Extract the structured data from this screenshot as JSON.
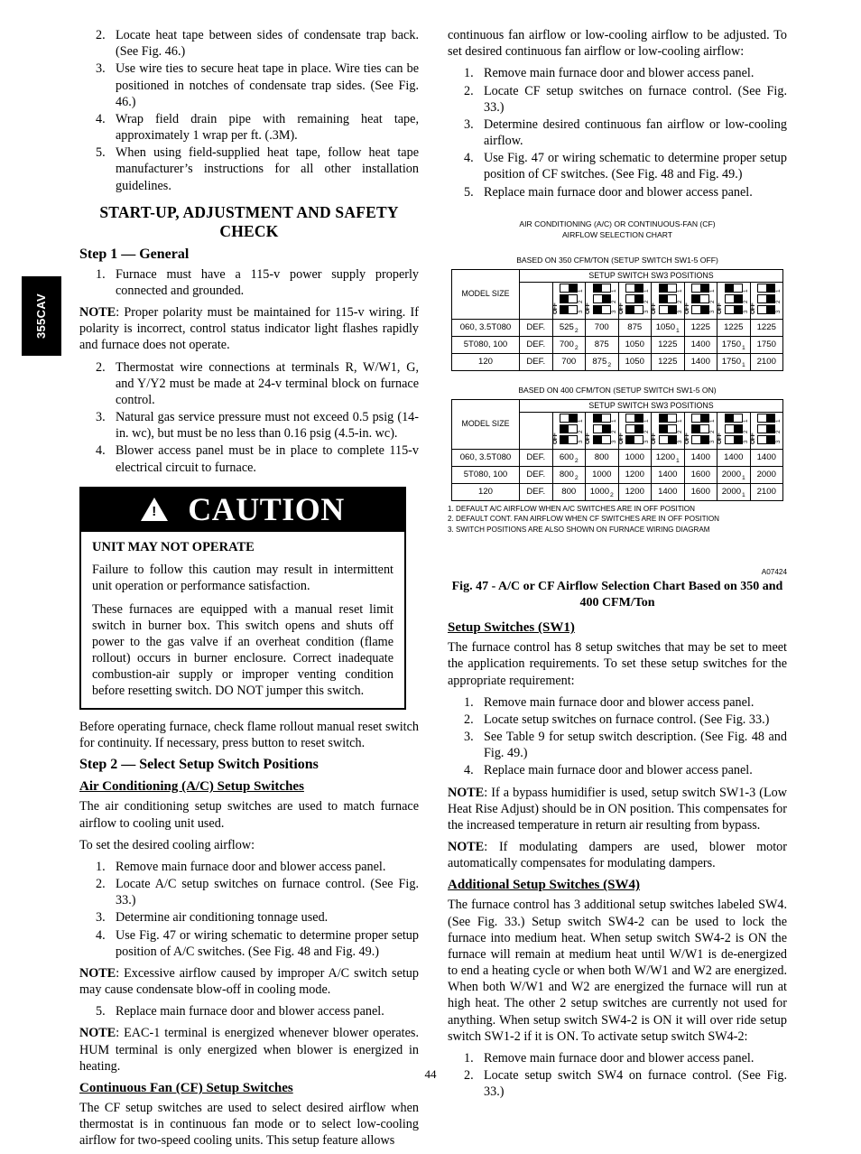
{
  "side_tab": {
    "label": "355CAV"
  },
  "page_number": "44",
  "left_column": {
    "list_a": [
      {
        "marker": "2.",
        "text": "Locate heat tape between sides of condensate trap back. (See Fig. 46.)"
      },
      {
        "marker": "3.",
        "text": "Use wire ties to secure heat tape in place. Wire ties can be positioned in notches of condensate trap sides. (See Fig. 46.)"
      },
      {
        "marker": "4.",
        "text": "Wrap field drain pipe with remaining heat tape, approximately 1 wrap per ft. (.3M)."
      },
      {
        "marker": "5.",
        "text": "When using field-supplied heat tape, follow heat tape manufacturer’s instructions for all other installation guidelines."
      }
    ],
    "section_heading": "START-UP, ADJUSTMENT AND SAFETY CHECK",
    "step1_heading": "Step 1 — General",
    "step1_item1_marker": "1.",
    "step1_item1": "Furnace must have a 115-v power supply properly connected and grounded.",
    "note1_label": "NOTE",
    "note1_text": ":  Proper polarity must be maintained for 115-v wiring. If polarity is incorrect, control status indicator light flashes rapidly and furnace does not operate.",
    "step1_rest": [
      {
        "marker": "2.",
        "text": "Thermostat wire connections at terminals R, W/W1, G, and Y/Y2 must be made at 24-v terminal block on furnace control."
      },
      {
        "marker": "3.",
        "text": "Natural gas service pressure must not exceed 0.5 psig (14-in. wc), but must be no less than 0.16 psig (4.5-in. wc)."
      },
      {
        "marker": "4.",
        "text": "Blower access panel must be in place to complete 115-v electrical circuit to furnace."
      }
    ],
    "caution": {
      "word": "CAUTION",
      "icon": "warning-triangle-icon",
      "title": "UNIT MAY NOT OPERATE",
      "paragraphs": [
        "Failure to follow this caution may result in intermittent unit operation or performance satisfaction.",
        "These furnaces are equipped with a manual reset limit switch in burner box. This switch opens and shuts off power to the gas valve if an overheat condition (flame rollout) occurs in burner enclosure. Correct inadequate combustion-air supply or improper venting condition before resetting switch. DO NOT jumper this switch."
      ]
    },
    "after_caution": "Before operating furnace, check flame rollout manual reset switch for continuity. If necessary, press button to reset switch.",
    "step2_heading": "Step 2 — Select Setup Switch Positions",
    "ac_heading": "Air Conditioning (A/C) Setup Switches",
    "ac_intro": "The air conditioning setup switches are used to match furnace airflow to cooling unit used.",
    "ac_lead": "To set the desired cooling airflow:",
    "ac_steps": [
      {
        "marker": "1.",
        "text": "Remove main furnace door and blower access panel."
      },
      {
        "marker": "2.",
        "text": "Locate A/C setup switches on furnace control. (See Fig. 33.)"
      },
      {
        "marker": "3.",
        "text": "Determine air conditioning tonnage used."
      },
      {
        "marker": "4.",
        "text": "Use Fig. 47 or wiring schematic to determine proper setup position of A/C switches. (See Fig. 48 and Fig. 49.)"
      }
    ],
    "note2_label": "NOTE",
    "note2_text": ":  Excessive airflow caused by improper A/C switch setup may cause condensate blow-off in cooling mode.",
    "ac_step5_marker": "5.",
    "ac_step5": "Replace main furnace door and blower access panel.",
    "note3_label": "NOTE",
    "note3_text": ":  EAC-1 terminal is energized whenever blower operates. HUM terminal is only energized when blower is energized in heating.",
    "cf_heading": "Continuous Fan (CF) Setup Switches",
    "cf_intro": "The CF setup switches are used to select desired airflow when thermostat is in continuous fan mode or to select low-cooling airflow for two-speed cooling units. This setup feature allows"
  },
  "right_column": {
    "cf_continued": "continuous fan airflow or low-cooling airflow to be adjusted. To set desired continuous fan airflow or low-cooling airflow:",
    "cf_steps": [
      {
        "marker": "1.",
        "text": "Remove main furnace door and blower access panel."
      },
      {
        "marker": "2.",
        "text": "Locate CF setup switches on furnace control. (See Fig. 33.)"
      },
      {
        "marker": "3.",
        "text": "Determine desired continuous fan airflow or low-cooling airflow."
      },
      {
        "marker": "4.",
        "text": "Use Fig. 47 or wiring schematic to determine proper setup position of CF switches. (See Fig. 48 and Fig. 49.)"
      },
      {
        "marker": "5.",
        "text": "Replace main furnace door and blower access panel."
      }
    ],
    "sw1_heading": "Setup Switches (SW1)",
    "sw1_intro": "The furnace control has 8 setup switches that may be set to meet the application requirements. To set these setup switches for the appropriate requirement:",
    "sw1_steps": [
      {
        "marker": "1.",
        "text": "Remove main furnace door and blower access panel."
      },
      {
        "marker": "2.",
        "text": "Locate setup switches on furnace control. (See Fig. 33.)"
      },
      {
        "marker": "3.",
        "text": "See Table 9 for setup switch description. (See Fig. 48 and Fig. 49.)"
      },
      {
        "marker": "4.",
        "text": "Replace main furnace door and blower access panel."
      }
    ],
    "note4_label": "NOTE",
    "note4_text": ":  If a bypass humidifier is used, setup switch SW1-3 (Low Heat Rise Adjust) should be in ON position. This compensates for the increased temperature in return air resulting from bypass.",
    "note5_label": "NOTE",
    "note5_text": ":       If modulating dampers are used, blower motor automatically compensates for modulating dampers.",
    "sw4_heading": "Additional Setup Switches (SW4)",
    "sw4_intro": "The furnace control has 3 additional setup switches labeled SW4. (See Fig. 33.) Setup switch SW4-2 can be used to lock the furnace into medium heat. When setup switch SW4-2 is ON the furnace will remain at medium heat until W/W1 is de-energized to end a heating cycle or when both W/W1 and W2 are energized. When both W/W1 and W2 are energized the furnace will run at high heat. The other 2 setup switches are currently not used for anything. When setup switch SW4-2 is ON it will over ride setup switch SW1-2 if it is ON. To activate setup switch SW4-2:",
    "sw4_steps": [
      {
        "marker": "1.",
        "text": "Remove main furnace door and blower access panel."
      },
      {
        "marker": "2.",
        "text": "Locate setup switch SW4 on furnace control. (See Fig. 33.)"
      }
    ]
  },
  "chart_data": {
    "type": "table",
    "title": "AIR CONDITIONING (A/C) OR CONTINUOUS-FAN (CF) AIRFLOW SELECTION CHART",
    "title_line1": "AIR CONDITIONING (A/C) OR CONTINUOUS-FAN (CF)",
    "title_line2": "AIRFLOW SELECTION CHART",
    "figure_id": "A07424",
    "figure_caption": "Fig. 47 - A/C or CF Airflow Selection Chart Based on 350 and 400 CFM/Ton",
    "column_header_group": "SETUP SWITCH SW3 POSITIONS",
    "row_header": "MODEL SIZE",
    "switch_labels": {
      "off": "OFF",
      "positions": [
        "1",
        "2",
        "3"
      ]
    },
    "footnotes": [
      "1. DEFAULT A/C AIRFLOW WHEN A/C SWITCHES ARE IN OFF POSITION",
      "2. DEFAULT CONT. FAN AIRFLOW WHEN CF SWITCHES ARE IN OFF POSITION",
      "3. SWITCH POSITIONS ARE ALSO SHOWN ON FURNACE WIRING DIAGRAM"
    ],
    "tables": [
      {
        "subtitle": "BASED ON 350 CFM/TON (SETUP SWITCH SW1-5 OFF)",
        "switch_patterns": [
          [
            1,
            0,
            0
          ],
          [
            0,
            1,
            0
          ],
          [
            1,
            1,
            0
          ],
          [
            0,
            0,
            1
          ],
          [
            1,
            0,
            1
          ],
          [
            0,
            1,
            1
          ],
          [
            1,
            1,
            1
          ]
        ],
        "rows": [
          {
            "model": "060, 3.5T080",
            "values": [
              "DEF.",
              "525",
              "700",
              "875",
              "1050",
              "1225",
              "1225",
              "1225"
            ],
            "notes": [
              "",
              "2",
              "",
              "",
              "1",
              "",
              "",
              ""
            ]
          },
          {
            "model": "5T080,  100",
            "values": [
              "DEF.",
              "700",
              "875",
              "1050",
              "1225",
              "1400",
              "1750",
              "1750"
            ],
            "notes": [
              "",
              "2",
              "",
              "",
              "",
              "",
              "1",
              ""
            ]
          },
          {
            "model": "120",
            "values": [
              "DEF.",
              "700",
              "875",
              "1050",
              "1225",
              "1400",
              "1750",
              "2100"
            ],
            "notes": [
              "",
              "",
              "2",
              "",
              "",
              "",
              "1",
              ""
            ]
          }
        ]
      },
      {
        "subtitle": "BASED ON 400 CFM/TON (SETUP SWITCH SW1-5 ON)",
        "switch_patterns": [
          [
            1,
            0,
            0
          ],
          [
            0,
            1,
            0
          ],
          [
            1,
            1,
            0
          ],
          [
            0,
            0,
            1
          ],
          [
            1,
            0,
            1
          ],
          [
            0,
            1,
            1
          ],
          [
            1,
            1,
            1
          ]
        ],
        "rows": [
          {
            "model": "060, 3.5T080",
            "values": [
              "DEF.",
              "600",
              "800",
              "1000",
              "1200",
              "1400",
              "1400",
              "1400"
            ],
            "notes": [
              "",
              "2",
              "",
              "",
              "1",
              "",
              "",
              ""
            ]
          },
          {
            "model": "5T080,  100",
            "values": [
              "DEF.",
              "800",
              "1000",
              "1200",
              "1400",
              "1600",
              "2000",
              "2000"
            ],
            "notes": [
              "",
              "2",
              "",
              "",
              "",
              "",
              "1",
              ""
            ]
          },
          {
            "model": "120",
            "values": [
              "DEF.",
              "800",
              "1000",
              "1200",
              "1400",
              "1600",
              "2000",
              "2100"
            ],
            "notes": [
              "",
              "",
              "2",
              "",
              "",
              "",
              "1",
              ""
            ]
          }
        ]
      }
    ]
  }
}
